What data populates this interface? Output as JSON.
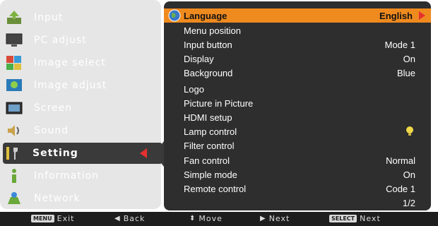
{
  "left_menu": {
    "items": [
      {
        "label": "Input",
        "icon": "input-icon"
      },
      {
        "label": "PC adjust",
        "icon": "pc-adjust-icon"
      },
      {
        "label": "Image select",
        "icon": "image-select-icon"
      },
      {
        "label": "Image adjust",
        "icon": "image-adjust-icon"
      },
      {
        "label": "Screen",
        "icon": "screen-icon"
      },
      {
        "label": "Sound",
        "icon": "sound-icon"
      },
      {
        "label": "Setting",
        "icon": "setting-icon"
      },
      {
        "label": "Information",
        "icon": "information-icon"
      },
      {
        "label": "Network",
        "icon": "network-icon"
      }
    ],
    "selected_index": 6
  },
  "settings": {
    "rows": [
      {
        "name": "Language",
        "value": "English"
      },
      {
        "name": "Menu position",
        "value": ""
      },
      {
        "name": "Input button",
        "value": "Mode 1"
      },
      {
        "name": "Display",
        "value": "On"
      },
      {
        "name": "Background",
        "value": "Blue"
      },
      {
        "name": "Logo",
        "value": ""
      },
      {
        "name": "Picture in Picture",
        "value": ""
      },
      {
        "name": "HDMI setup",
        "value": ""
      },
      {
        "name": "Lamp control",
        "value": ""
      },
      {
        "name": "Filter control",
        "value": ""
      },
      {
        "name": "Fan control",
        "value": "Normal"
      },
      {
        "name": "Simple mode",
        "value": "On"
      },
      {
        "name": "Remote control",
        "value": "Code 1"
      }
    ],
    "page_indicator": "1/2"
  },
  "bottom_bar": {
    "exit_key": "MENU",
    "exit_label": "Exit",
    "back_label": "Back",
    "move_label": "Move",
    "next_label": "Next",
    "select_key": "SELECT",
    "select_label": "Next"
  },
  "colors": {
    "highlight": "#ef8a1f",
    "panel_dark": "#2e2e2e",
    "panel_light": "#e6e6e6",
    "arrow_red": "#e53030"
  }
}
